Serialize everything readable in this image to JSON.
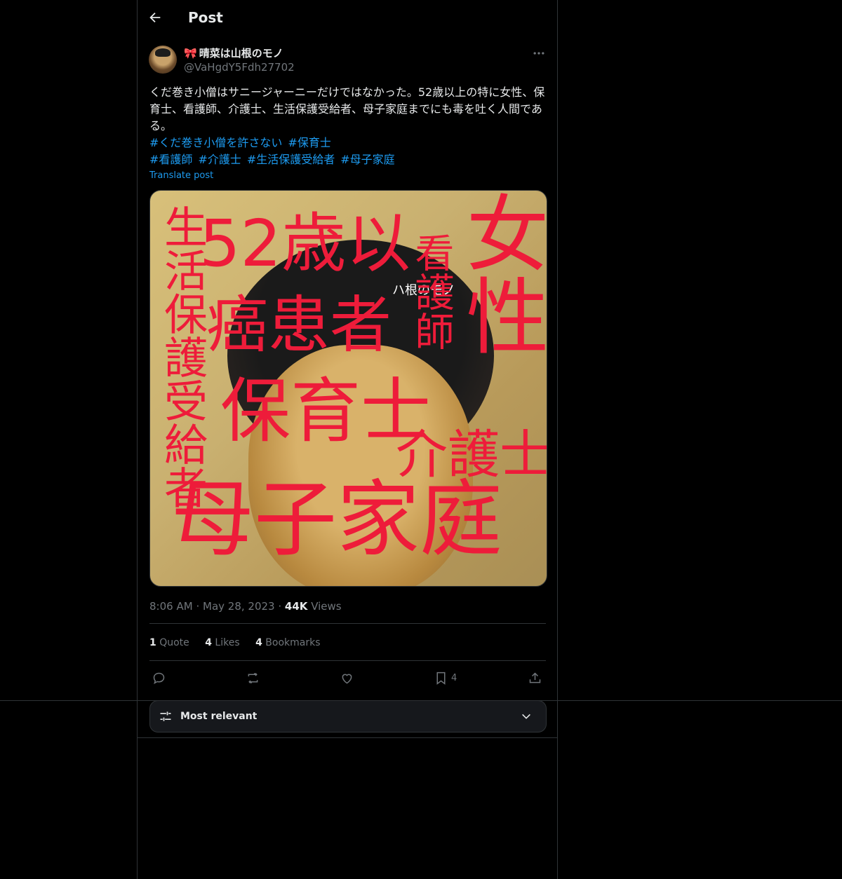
{
  "header": {
    "title": "Post"
  },
  "author": {
    "ribbon": "🎀",
    "name": "晴菜は山根のモノ",
    "handle": "@VaHgdY5Fdh27702"
  },
  "post": {
    "text": "くだ巻き小僧はサニージャーニーだけではなかった。52歳以上の特に女性、保育士、看護師、介護士、生活保護受給者、母子家庭までにも毒を吐く人間である。",
    "hashtags_line1": [
      "#くだ巻き小僧を許さない",
      "#保育士"
    ],
    "hashtags_line2": [
      "#看護師",
      "#介護士",
      "#生活保護受給者",
      "#母子家庭"
    ],
    "translate": "Translate post"
  },
  "media": {
    "overlay": {
      "t1": "52歳以",
      "t2": "癌患者",
      "t3": "保育士",
      "t4": "母子家庭",
      "t5": "介護士",
      "v1": "生活保護受給者",
      "v2": "看護師",
      "v3": "女性",
      "small": "ハ根のモノ"
    }
  },
  "meta": {
    "time": "8:06 AM",
    "date": "May 28, 2023",
    "views_count": "44K",
    "views_label": "Views",
    "dot": "·"
  },
  "stats": {
    "quotes_count": "1",
    "quotes_label": "Quote",
    "likes_count": "4",
    "likes_label": "Likes",
    "bookmarks_count": "4",
    "bookmarks_label": "Bookmarks"
  },
  "actions": {
    "bookmark_count": "4"
  },
  "sort": {
    "label": "Most relevant"
  }
}
